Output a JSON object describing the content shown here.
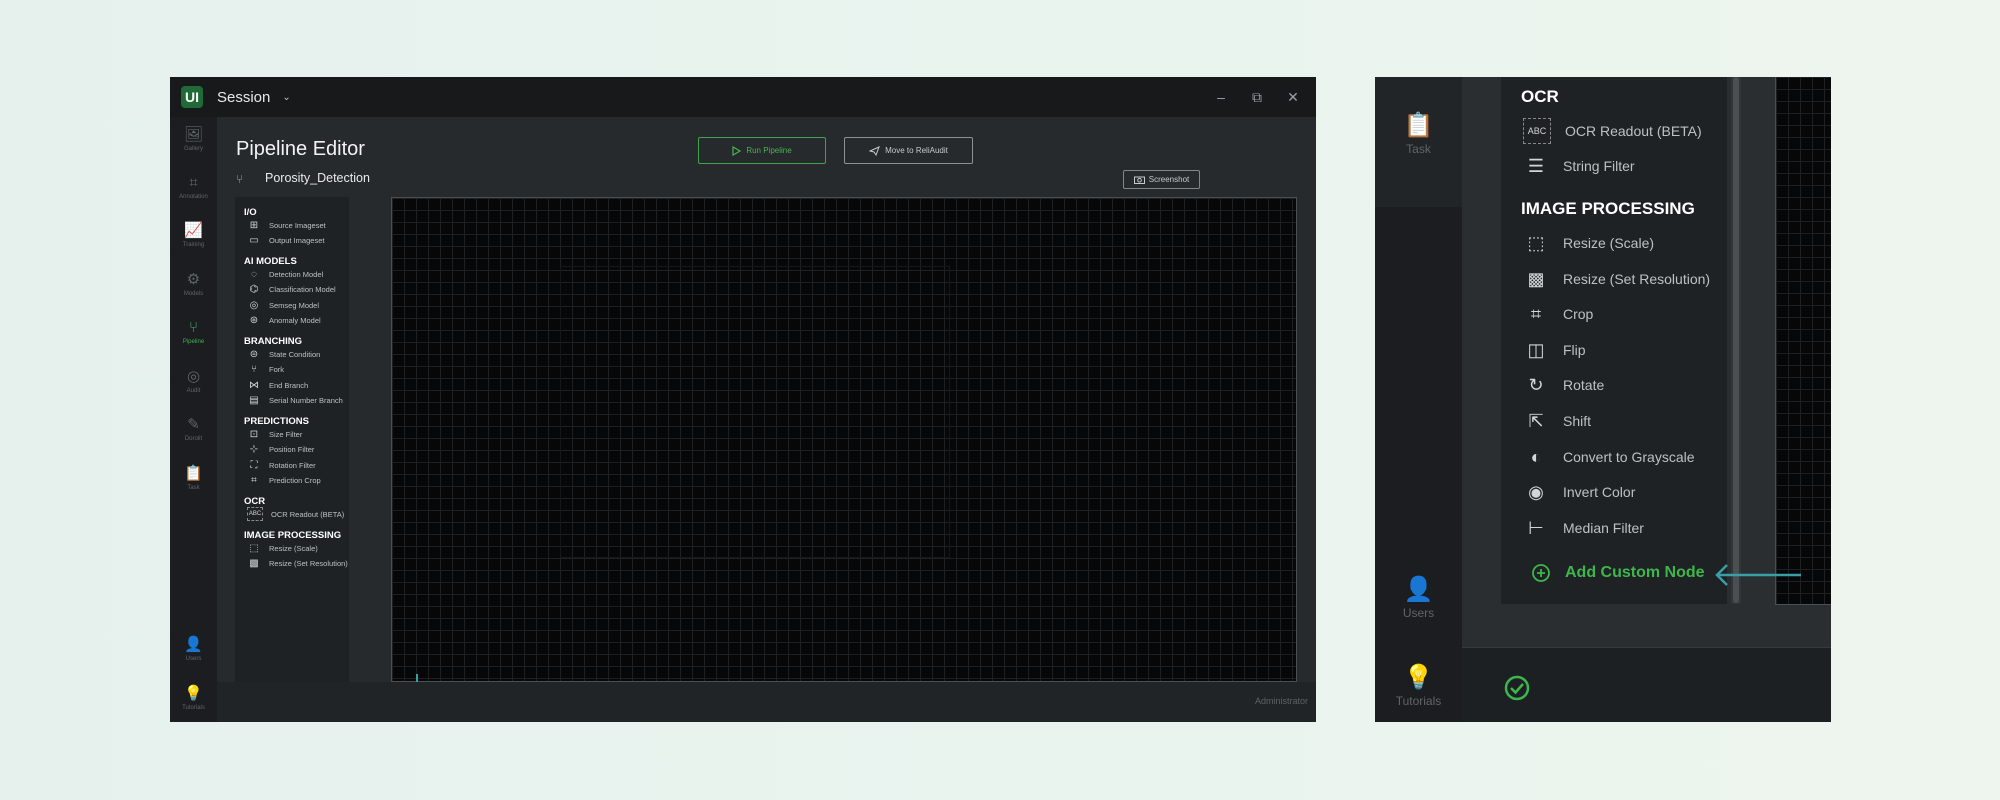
{
  "window": {
    "logo": "UI",
    "session_label": "Session",
    "session_caret": "⌄",
    "controls": [
      "–",
      "⧉",
      "✕"
    ]
  },
  "rail": [
    {
      "id": "gallery",
      "icon": "🖼",
      "label": "Gallery"
    },
    {
      "id": "annotation",
      "icon": "⌗",
      "label": "Annotation"
    },
    {
      "id": "training",
      "icon": "📈",
      "label": "Training"
    },
    {
      "id": "models",
      "icon": "⚙",
      "label": "Models"
    },
    {
      "id": "pipeline",
      "icon": "⑂",
      "label": "Pipeline"
    },
    {
      "id": "audit",
      "icon": "◎",
      "label": "Audit"
    },
    {
      "id": "dorolit",
      "icon": "✎",
      "label": "Dorolit"
    },
    {
      "id": "task",
      "icon": "📋",
      "label": "Task"
    },
    {
      "id": "users",
      "icon": "👤",
      "label": "Users"
    },
    {
      "id": "tutorials",
      "icon": "💡",
      "label": "Tutorials"
    }
  ],
  "editor": {
    "title": "Pipeline Editor",
    "project_name": "Porosity_Detection",
    "run_label": "Run Pipeline",
    "move_label": "Move to ReliAudit",
    "screenshot_label": "Screenshot",
    "footer_user": "Administrator"
  },
  "palette": {
    "io": {
      "title": "I/O",
      "items": [
        "Source Imageset",
        "Output Imageset"
      ]
    },
    "ai_models": {
      "title": "AI MODELS",
      "items": [
        "Detection Model",
        "Classification Model",
        "Semseg Model",
        "Anomaly Model"
      ]
    },
    "branching": {
      "title": "BRANCHING",
      "items": [
        "State Condition",
        "Fork",
        "End Branch",
        "Serial Number Branch"
      ]
    },
    "predictions": {
      "title": "PREDICTIONS",
      "items": [
        "Size Filter",
        "Position Filter",
        "Rotation Filter",
        "Prediction Crop"
      ]
    },
    "ocr": {
      "title": "OCR",
      "items": [
        "OCR Readout (BETA)"
      ]
    },
    "image_processing": {
      "title": "IMAGE PROCESSING",
      "items": [
        "Resize (Scale)",
        "Resize (Set Resolution)"
      ]
    }
  },
  "zoom": {
    "ocr": {
      "title": "OCR",
      "items": [
        "OCR Readout (BETA)",
        "String Filter"
      ]
    },
    "image_processing": {
      "title": "IMAGE PROCESSING",
      "items": [
        "Resize (Scale)",
        "Resize (Set Resolution)",
        "Crop",
        "Flip",
        "Rotate",
        "Shift",
        "Convert to Grayscale",
        "Invert Color",
        "Median Filter"
      ]
    },
    "add_custom_node": "Add Custom Node",
    "rail": {
      "task": "Task",
      "users": "Users",
      "tutorials": "Tutorials"
    }
  },
  "colors": {
    "accent_green": "#3db64c",
    "callout_arrow": "#3a9ea6",
    "background": "#e8f3ef"
  }
}
